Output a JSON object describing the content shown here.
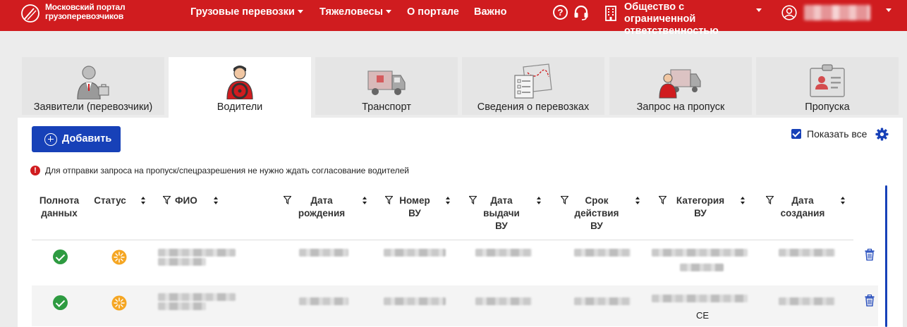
{
  "header": {
    "brand": "Московский портал грузоперевозчиков",
    "nav": [
      {
        "label": "Грузовые перевозки",
        "has_dropdown": true
      },
      {
        "label": "Тяжеловесы",
        "has_dropdown": true
      },
      {
        "label": "О портале",
        "has_dropdown": false
      },
      {
        "label": "Важно",
        "has_dropdown": false
      }
    ],
    "help_glyph": "?",
    "org_name": "Общество с ограниченной ответственностью",
    "icons": [
      "logo-icon",
      "help-icon",
      "headset-icon",
      "building-icon",
      "user-icon"
    ],
    "background_color": "#d01c1f"
  },
  "tabs": [
    {
      "label": "Заявители (перевозчики)",
      "icon": "businessman-icon",
      "active": false
    },
    {
      "label": "Водители",
      "icon": "driver-icon",
      "active": true
    },
    {
      "label": "Транспорт",
      "icon": "truck-icon",
      "active": false
    },
    {
      "label": "Сведения о перевозках",
      "icon": "route-documents-icon",
      "active": false
    },
    {
      "label": "Запрос на пропуск",
      "icon": "truck-driver-icon",
      "active": false
    },
    {
      "label": "Пропуска",
      "icon": "id-card-icon",
      "active": false
    }
  ],
  "toolbar": {
    "add_label": "Добавить",
    "show_all_label": "Показать все",
    "show_all_checked": true,
    "accent_color": "#1741b8"
  },
  "notice": {
    "icon_glyph": "!",
    "text": "Для отправки запроса на пропуск/спецразрешения не нужно ждать согласование водителей"
  },
  "table": {
    "columns": [
      {
        "label": "Полнота данных",
        "filter": false,
        "sort": false
      },
      {
        "label": "Статус",
        "filter": false,
        "sort": true
      },
      {
        "label": "ФИО",
        "filter": true,
        "sort": true
      },
      {
        "label": "Дата рождения",
        "filter": true,
        "sort": true
      },
      {
        "label": "Номер ВУ",
        "filter": true,
        "sort": true
      },
      {
        "label": "Дата выдачи ВУ",
        "filter": true,
        "sort": true
      },
      {
        "label": "Срок действия ВУ",
        "filter": true,
        "sort": true
      },
      {
        "label": "Категория ВУ",
        "filter": true,
        "sort": true
      },
      {
        "label": "Дата создания",
        "filter": true,
        "sort": true
      }
    ],
    "rows": [
      {
        "completeness": "complete",
        "status": "pending",
        "category_extra": ""
      },
      {
        "completeness": "complete",
        "status": "pending",
        "category_extra": "CE"
      }
    ],
    "status_colors": {
      "complete": "#2e9b41",
      "pending": "#f5a623"
    }
  }
}
